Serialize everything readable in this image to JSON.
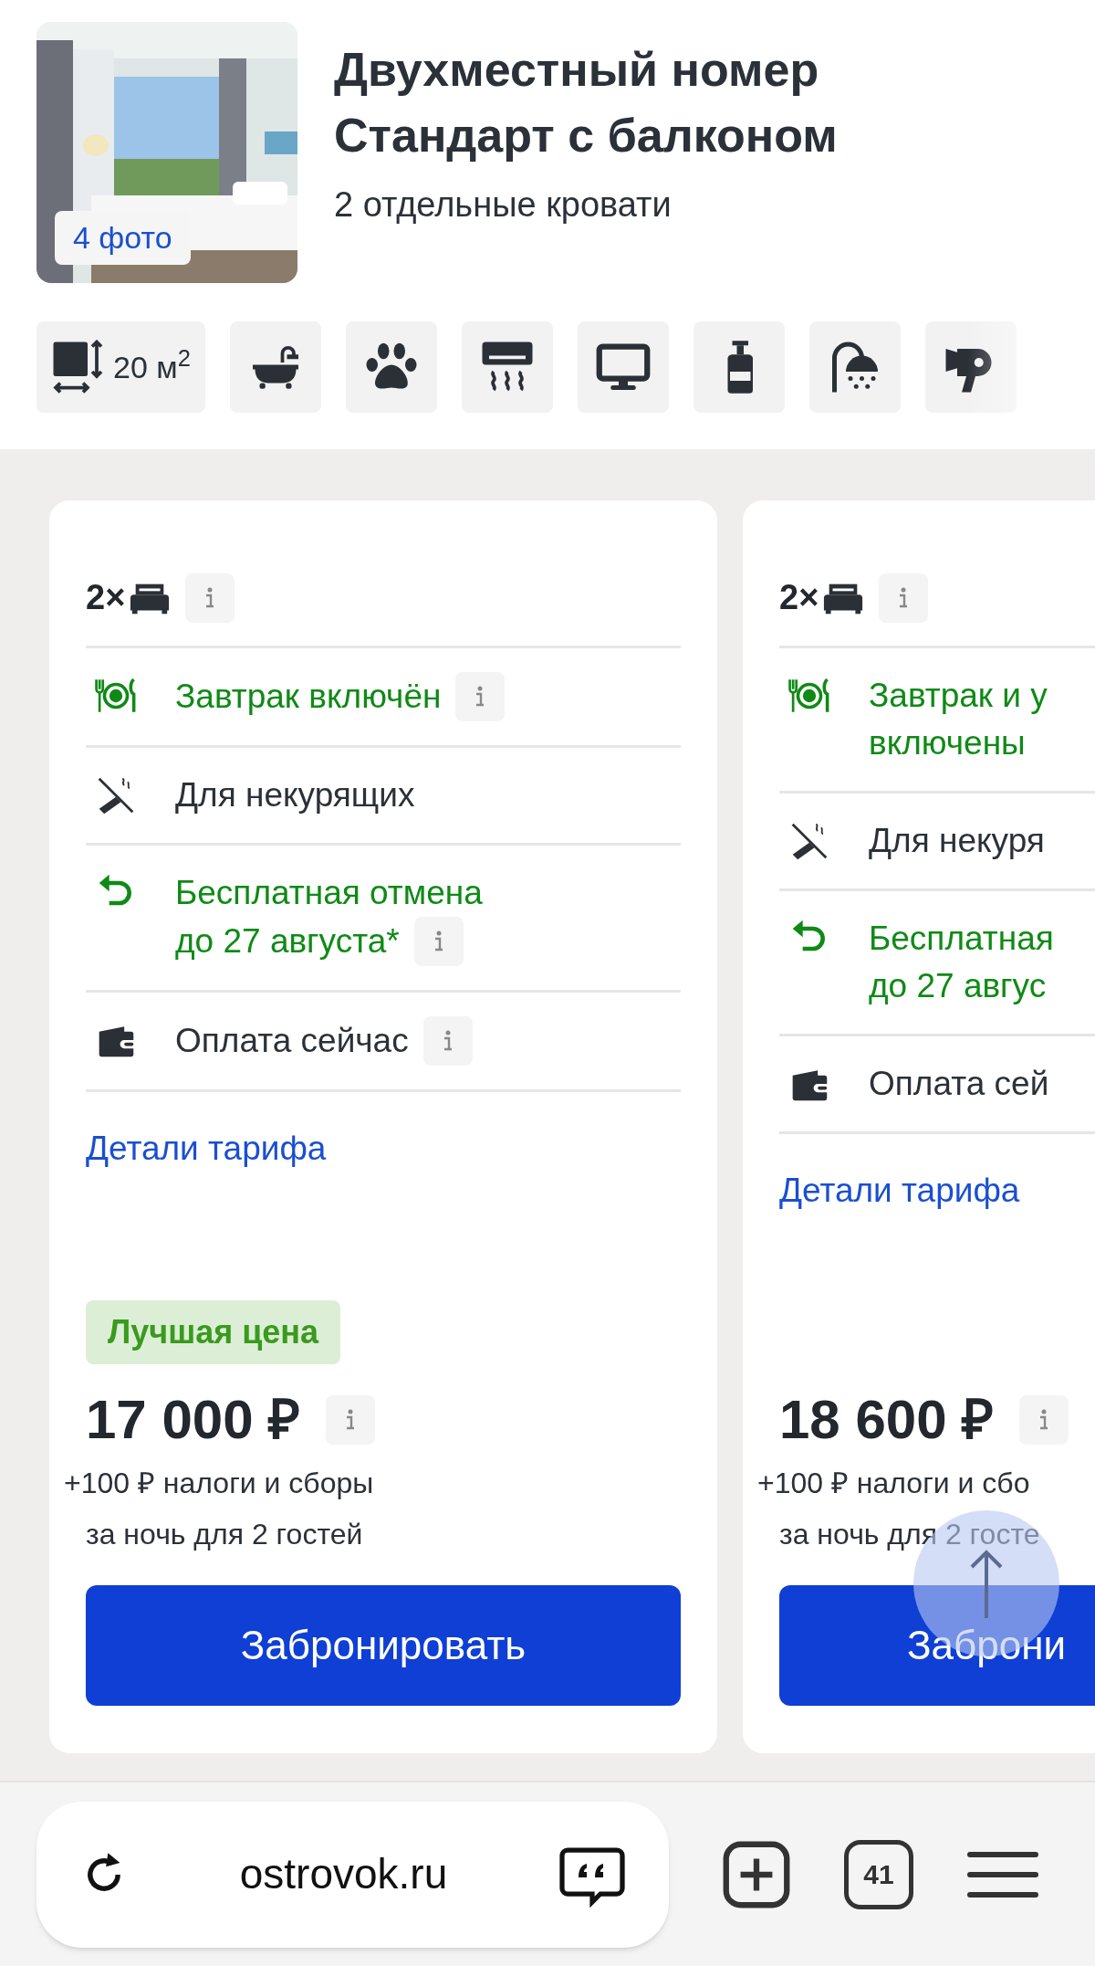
{
  "room": {
    "title_lines": [
      "Двухместный номер",
      "Стандарт с балконом"
    ],
    "beds": "2 отдельные кровати",
    "photo": {
      "kind": "picture",
      "count_label": "4 фото"
    }
  },
  "amenities": [
    {
      "kind": "area",
      "label": "20 м$^{2}$"
    },
    {
      "kind": "bath"
    },
    {
      "kind": "pets"
    },
    {
      "kind": "ac"
    },
    {
      "kind": "tv"
    },
    {
      "kind": "toiletries"
    },
    {
      "kind": "shower"
    },
    {
      "kind": "hairdryer"
    }
  ],
  "rates": [
    {
      "bed_count": "2×",
      "rows": [
        {
          "kind": "meal",
          "lines": [
            "Завтрак включён"
          ],
          "positive": true,
          "info": true
        },
        {
          "kind": "nosmoking",
          "lines": [
            "Для некурящих"
          ],
          "positive": false,
          "info": false
        },
        {
          "kind": "cancel",
          "lines": [
            "Бесплатная отмена",
            "до 27 августа*"
          ],
          "positive": true,
          "info": true
        },
        {
          "kind": "wallet",
          "lines": [
            "Оплата сейчас"
          ],
          "positive": false,
          "info": true
        }
      ],
      "details_link": "Детали тарифа",
      "badge": "Лучшая цена",
      "price": "17 000 ₽",
      "taxes": "+100 ₽ налоги и сборы",
      "per_night": "за ночь для 2 гостей",
      "book_button": "Забронировать"
    },
    {
      "bed_count": "2×",
      "rows": [
        {
          "kind": "meal",
          "lines": [
            "Завтрак и у",
            "включены"
          ],
          "positive": true,
          "info": false
        },
        {
          "kind": "nosmoking",
          "lines": [
            "Для некуря"
          ],
          "positive": false,
          "info": false
        },
        {
          "kind": "cancel",
          "lines": [
            "Бесплатная",
            "до 27 авгус"
          ],
          "positive": true,
          "info": false
        },
        {
          "kind": "wallet",
          "lines": [
            "Оплата сей"
          ],
          "positive": false,
          "info": false
        }
      ],
      "details_link": "Детали тарифа",
      "price": "18 600 ₽",
      "taxes": "+100 ₽ налоги и сбо",
      "per_night": "за ночь для 2 госте",
      "book_button": "Заброни"
    }
  ],
  "browser_bar": {
    "url": "ostrovok.ru",
    "tab_count": "41"
  }
}
